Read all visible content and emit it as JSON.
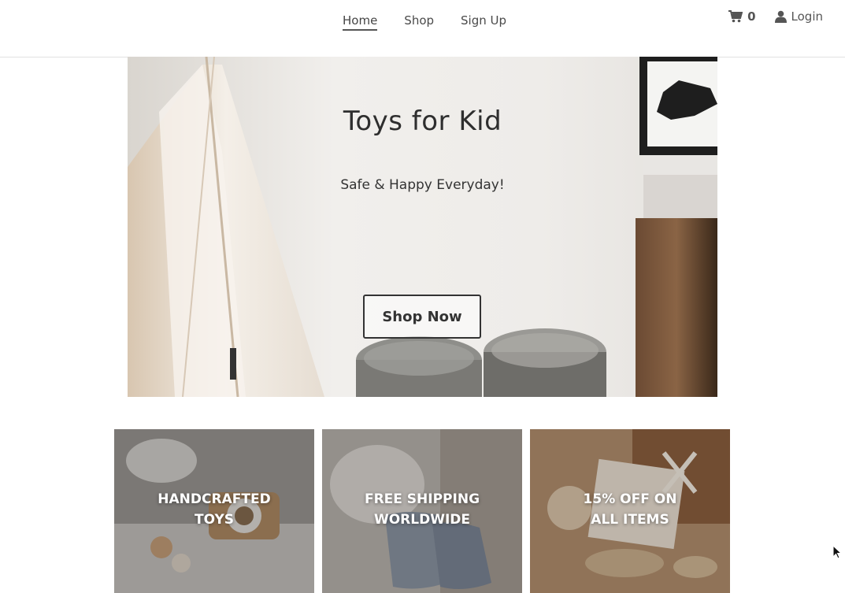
{
  "nav": {
    "links": [
      {
        "label": "Home",
        "active": true
      },
      {
        "label": "Shop"
      },
      {
        "label": "Sign Up"
      }
    ],
    "cart_icon": "cart-icon",
    "cart_count": "0",
    "login_icon": "user-icon",
    "login_label": "Login"
  },
  "hero": {
    "title": "Toys for Kid",
    "subtitle": "Safe & Happy Everyday!",
    "button_label": "Shop Now"
  },
  "cards": [
    {
      "line1": "HANDCRAFTED",
      "line2": "TOYS"
    },
    {
      "line1": "FREE SHIPPING",
      "line2": "WORLDWIDE"
    },
    {
      "line1": "15% OFF ON",
      "line2": "ALL ITEMS"
    }
  ]
}
